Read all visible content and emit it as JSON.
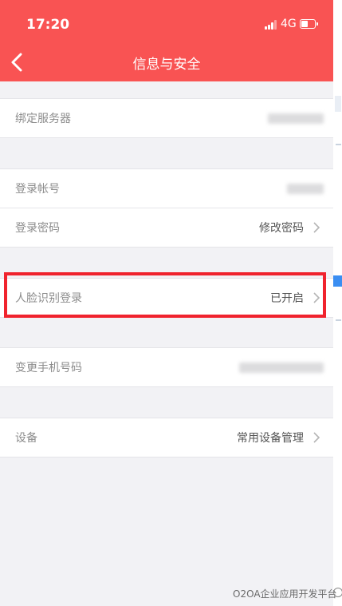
{
  "status_bar": {
    "time": "17:20",
    "network": "4G"
  },
  "nav": {
    "title": "信息与安全",
    "back_icon": "chevron-left-icon"
  },
  "sections": {
    "server": {
      "rows": [
        {
          "label": "绑定服务器",
          "value": "",
          "value_obscured": true,
          "chevron": false
        }
      ]
    },
    "account": {
      "rows": [
        {
          "label": "登录帐号",
          "value": "",
          "value_obscured": true,
          "chevron": false
        },
        {
          "label": "登录密码",
          "value": "修改密码",
          "chevron": true
        }
      ]
    },
    "face": {
      "rows": [
        {
          "label": "人脸识别登录",
          "value": "已开启",
          "chevron": true
        }
      ]
    },
    "phone": {
      "rows": [
        {
          "label": "变更手机号码",
          "value": "",
          "value_obscured": true,
          "chevron": false
        }
      ]
    },
    "device": {
      "rows": [
        {
          "label": "设备",
          "value": "常用设备管理",
          "chevron": true
        }
      ]
    }
  },
  "annotation": {
    "highlight_color": "#f0232d"
  },
  "watermark": {
    "text": "O2OA企业应用开发平台"
  },
  "colors": {
    "header_bg": "#f95353",
    "page_bg": "#f2f2f5",
    "label": "#8c8c8c",
    "value": "#555555"
  }
}
